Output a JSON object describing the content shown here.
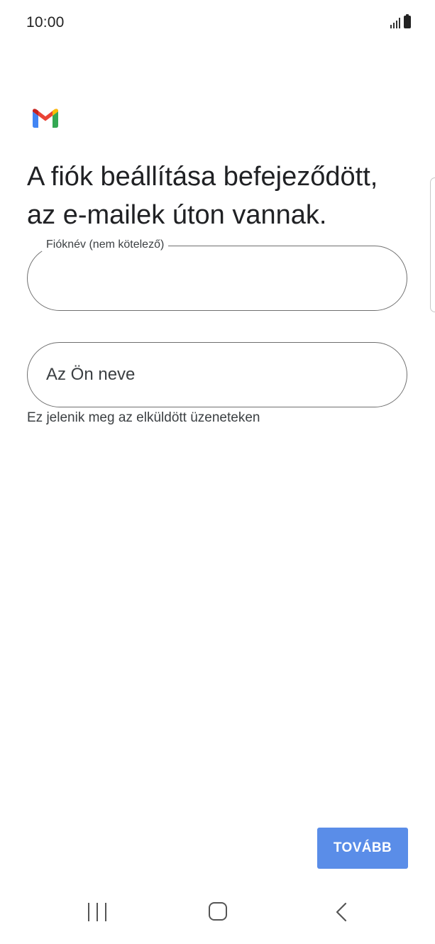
{
  "status_bar": {
    "time": "10:00",
    "icons": [
      "signal-icon",
      "battery-icon"
    ]
  },
  "app": {
    "logo": "gmail-logo",
    "title": "A fiók beállítása befejeződött, az e-mailek úton vannak."
  },
  "form": {
    "account_name": {
      "label": "Fióknév (nem kötelező)",
      "value": ""
    },
    "your_name": {
      "placeholder": "Az Ön neve",
      "value": "",
      "helper": "Ez jelenik meg az elküldött üzeneteken"
    }
  },
  "actions": {
    "next_label": "TOVÁBB"
  },
  "colors": {
    "accent": "#5a8de8",
    "gmail_red": "#ea4335",
    "gmail_blue": "#4285f4",
    "gmail_green": "#34a853",
    "gmail_yellow": "#fbbc04"
  },
  "nav_bar": {
    "icons": [
      "recents-icon",
      "home-icon",
      "back-icon"
    ]
  }
}
